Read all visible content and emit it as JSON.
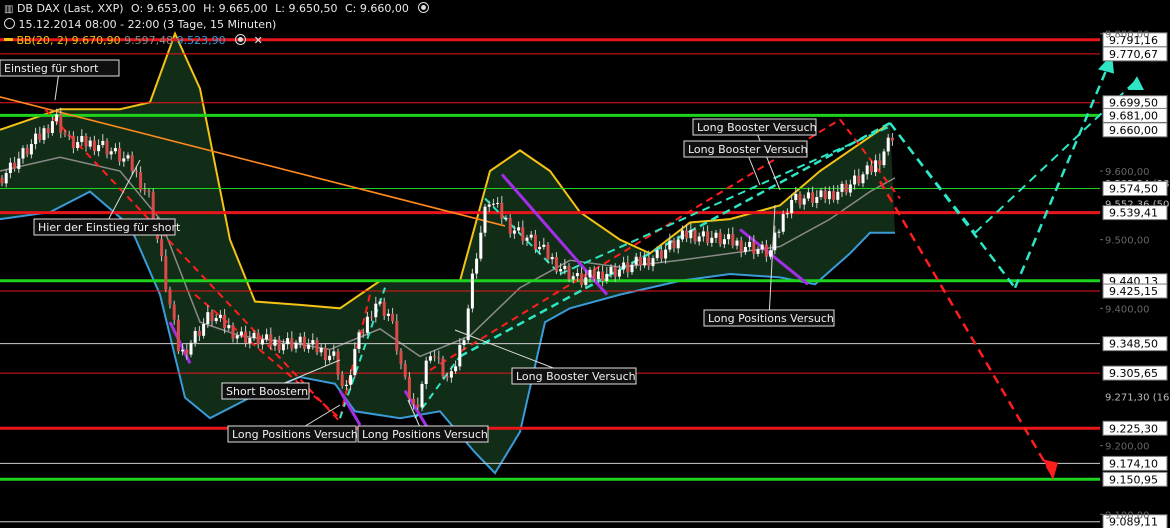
{
  "header": {
    "instrument": "DB DAX (Last, XXP)",
    "open": "O: 9.653,00",
    "high": "H: 9.665,00",
    "low": "L: 9.650,50",
    "close": "C: 9.660,00",
    "timeframe": "15.12.2014 08:00 - 22:00 (3 Tage, 15 Minuten)",
    "indicator_name": "BB(20, 2)",
    "bb_upper": "9.670,90",
    "bb_mid": "9.597,48",
    "bb_lower": "9.523,90"
  },
  "colors": {
    "background": "#000000",
    "bb_upper": "#f3c316",
    "bb_mid": "#8a8a8a",
    "bb_lower": "#3a9bd8",
    "bb_fill": "#14321a",
    "candle_up": "#ffffff",
    "candle_down": "#d94a4a",
    "red_level": "#e8161b",
    "green_level": "#1ed31e",
    "white_level": "#cfcfcf",
    "teal_projection": "#2ee6c5",
    "red_projection": "#ff1e1e",
    "purple": "#a22ee6",
    "orange": "#ff8a1e"
  },
  "chart_data": {
    "type": "candlestick",
    "ylim": [
      9080,
      9820
    ],
    "tick_labels": [
      "9.800,00",
      "9.600,00",
      "9.500,00",
      "9.400,00",
      "9.200,00",
      "9.100,00"
    ],
    "tick_values": [
      9800,
      9600,
      9500,
      9400,
      9200,
      9100
    ],
    "levels": [
      {
        "value": 9791.16,
        "label": "9.791,16",
        "color": "red",
        "style": "thick"
      },
      {
        "value": 9770.67,
        "label": "9.770,67",
        "color": "red",
        "style": "thin"
      },
      {
        "value": 9699.5,
        "label": "9.699,50",
        "color": "red",
        "style": "thin"
      },
      {
        "value": 9681.0,
        "label": "9.681,00",
        "color": "green",
        "style": "thick"
      },
      {
        "value": 9660.0,
        "label": "9.660,00",
        "color": "none",
        "style": "price"
      },
      {
        "value": 9582.24,
        "label": "9.582,24 (38",
        "color": "none",
        "style": "text"
      },
      {
        "value": 9574.5,
        "label": "9.574,50",
        "color": "green",
        "style": "thin"
      },
      {
        "value": 9552.36,
        "label": "9.552,36 (50",
        "color": "none",
        "style": "text"
      },
      {
        "value": 9539.41,
        "label": "9.539,41",
        "color": "red",
        "style": "thick"
      },
      {
        "value": 9440.13,
        "label": "9.440,13",
        "color": "green",
        "style": "thick"
      },
      {
        "value": 9425.15,
        "label": "9.425,15",
        "color": "red",
        "style": "thin"
      },
      {
        "value": 9348.5,
        "label": "9.348,50",
        "color": "white",
        "style": "thin"
      },
      {
        "value": 9305.65,
        "label": "9.305,65",
        "color": "red",
        "style": "thin"
      },
      {
        "value": 9271.3,
        "label": "9.271,30 (16",
        "color": "none",
        "style": "text"
      },
      {
        "value": 9225.3,
        "label": "9.225,30",
        "color": "red",
        "style": "thick"
      },
      {
        "value": 9174.1,
        "label": "9.174,10",
        "color": "white",
        "style": "thin"
      },
      {
        "value": 9150.95,
        "label": "9.150,95",
        "color": "green",
        "style": "thick"
      },
      {
        "value": 9089.11,
        "label": "9.089,11",
        "color": "white",
        "style": "thin"
      }
    ],
    "annotations": [
      {
        "text": "Einstieg für short"
      },
      {
        "text": "Hier der Einstieg für short"
      },
      {
        "text": "Short Boostern"
      },
      {
        "text": "Long Positions Versuch"
      },
      {
        "text": "Long Positions Versuch"
      },
      {
        "text": "Long Booster Versuch"
      },
      {
        "text": "Long Booster Versuch"
      },
      {
        "text": "Long Booster Versuch"
      },
      {
        "text": "Long Positions Versuch"
      }
    ],
    "bb_upper_path": [
      [
        0,
        9660
      ],
      [
        60,
        9690
      ],
      [
        120,
        9690
      ],
      [
        150,
        9700
      ],
      [
        175,
        9800
      ],
      [
        200,
        9720
      ],
      [
        230,
        9500
      ],
      [
        255,
        9410
      ],
      [
        300,
        9405
      ],
      [
        340,
        9400
      ],
      [
        380,
        9440
      ],
      [
        420,
        9440
      ],
      [
        460,
        9440
      ],
      [
        490,
        9600
      ],
      [
        520,
        9630
      ],
      [
        550,
        9600
      ],
      [
        580,
        9540
      ],
      [
        620,
        9500
      ],
      [
        650,
        9480
      ],
      [
        690,
        9525
      ],
      [
        730,
        9530
      ],
      [
        780,
        9550
      ],
      [
        820,
        9600
      ],
      [
        860,
        9640
      ],
      [
        890,
        9670
      ]
    ],
    "bb_mid_path": [
      [
        0,
        9600
      ],
      [
        60,
        9620
      ],
      [
        120,
        9600
      ],
      [
        160,
        9530
      ],
      [
        200,
        9380
      ],
      [
        240,
        9360
      ],
      [
        290,
        9350
      ],
      [
        330,
        9340
      ],
      [
        380,
        9370
      ],
      [
        420,
        9330
      ],
      [
        470,
        9360
      ],
      [
        520,
        9430
      ],
      [
        570,
        9470
      ],
      [
        620,
        9460
      ],
      [
        680,
        9470
      ],
      [
        730,
        9480
      ],
      [
        780,
        9490
      ],
      [
        830,
        9530
      ],
      [
        870,
        9570
      ],
      [
        895,
        9590
      ]
    ],
    "bb_lower_path": [
      [
        0,
        9530
      ],
      [
        50,
        9540
      ],
      [
        90,
        9570
      ],
      [
        130,
        9520
      ],
      [
        160,
        9420
      ],
      [
        185,
        9270
      ],
      [
        210,
        9240
      ],
      [
        250,
        9270
      ],
      [
        300,
        9300
      ],
      [
        335,
        9290
      ],
      [
        355,
        9250
      ],
      [
        400,
        9240
      ],
      [
        440,
        9250
      ],
      [
        475,
        9190
      ],
      [
        495,
        9160
      ],
      [
        520,
        9220
      ],
      [
        545,
        9380
      ],
      [
        570,
        9400
      ],
      [
        620,
        9420
      ],
      [
        680,
        9440
      ],
      [
        730,
        9450
      ],
      [
        780,
        9445
      ],
      [
        815,
        9435
      ],
      [
        850,
        9480
      ],
      [
        870,
        9510
      ],
      [
        895,
        9510
      ]
    ],
    "price_path": [
      [
        0,
        9590
      ],
      [
        20,
        9620
      ],
      [
        40,
        9650
      ],
      [
        55,
        9680
      ],
      [
        70,
        9640
      ],
      [
        100,
        9640
      ],
      [
        130,
        9610
      ],
      [
        150,
        9560
      ],
      [
        165,
        9440
      ],
      [
        180,
        9330
      ],
      [
        195,
        9360
      ],
      [
        210,
        9390
      ],
      [
        240,
        9360
      ],
      [
        270,
        9350
      ],
      [
        300,
        9350
      ],
      [
        335,
        9330
      ],
      [
        345,
        9270
      ],
      [
        355,
        9340
      ],
      [
        375,
        9410
      ],
      [
        390,
        9390
      ],
      [
        405,
        9290
      ],
      [
        415,
        9250
      ],
      [
        430,
        9340
      ],
      [
        450,
        9290
      ],
      [
        465,
        9370
      ],
      [
        475,
        9470
      ],
      [
        488,
        9560
      ],
      [
        510,
        9520
      ],
      [
        530,
        9500
      ],
      [
        560,
        9460
      ],
      [
        580,
        9440
      ],
      [
        600,
        9450
      ],
      [
        630,
        9460
      ],
      [
        660,
        9480
      ],
      [
        690,
        9510
      ],
      [
        720,
        9500
      ],
      [
        750,
        9490
      ],
      [
        770,
        9480
      ],
      [
        790,
        9560
      ],
      [
        820,
        9560
      ],
      [
        850,
        9580
      ],
      [
        870,
        9600
      ],
      [
        880,
        9620
      ],
      [
        895,
        9660
      ]
    ]
  }
}
